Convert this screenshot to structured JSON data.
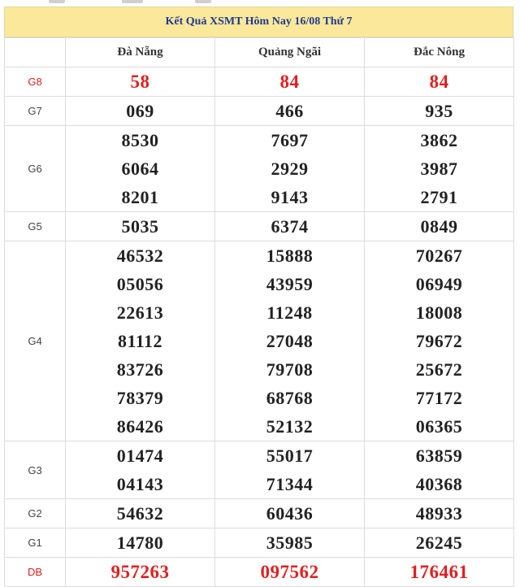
{
  "title": "Kết Quả XSMT Hôm Nay 16/08 Thứ 7",
  "provinces": [
    "Đà Nẵng",
    "Quảng Ngãi",
    "Đắc Nông"
  ],
  "colors": {
    "header_bg": "#fbe89a",
    "title_text": "#1f3a93",
    "highlight": "#e02020"
  },
  "rows": [
    {
      "prize": "G8",
      "highlight": true,
      "cells": [
        [
          "58"
        ],
        [
          "84"
        ],
        [
          "84"
        ]
      ]
    },
    {
      "prize": "G7",
      "highlight": false,
      "cells": [
        [
          "069"
        ],
        [
          "466"
        ],
        [
          "935"
        ]
      ]
    },
    {
      "prize": "G6",
      "highlight": false,
      "cells": [
        [
          "8530",
          "6064",
          "8201"
        ],
        [
          "7697",
          "2929",
          "9143"
        ],
        [
          "3862",
          "3987",
          "2791"
        ]
      ]
    },
    {
      "prize": "G5",
      "highlight": false,
      "cells": [
        [
          "5035"
        ],
        [
          "6374"
        ],
        [
          "0849"
        ]
      ]
    },
    {
      "prize": "G4",
      "highlight": false,
      "cells": [
        [
          "46532",
          "05056",
          "22613",
          "81112",
          "83726",
          "78379",
          "86426"
        ],
        [
          "15888",
          "43959",
          "11248",
          "27048",
          "79708",
          "68768",
          "52132"
        ],
        [
          "70267",
          "06949",
          "18008",
          "79672",
          "25672",
          "77172",
          "06365"
        ]
      ]
    },
    {
      "prize": "G3",
      "highlight": false,
      "cells": [
        [
          "01474",
          "04143"
        ],
        [
          "55017",
          "71344"
        ],
        [
          "63859",
          "40368"
        ]
      ]
    },
    {
      "prize": "G2",
      "highlight": false,
      "cells": [
        [
          "54632"
        ],
        [
          "60436"
        ],
        [
          "48933"
        ]
      ]
    },
    {
      "prize": "G1",
      "highlight": false,
      "cells": [
        [
          "14780"
        ],
        [
          "35985"
        ],
        [
          "26245"
        ]
      ]
    },
    {
      "prize": "DB",
      "highlight": true,
      "cells": [
        [
          "957263"
        ],
        [
          "097562"
        ],
        [
          "176461"
        ]
      ]
    }
  ]
}
